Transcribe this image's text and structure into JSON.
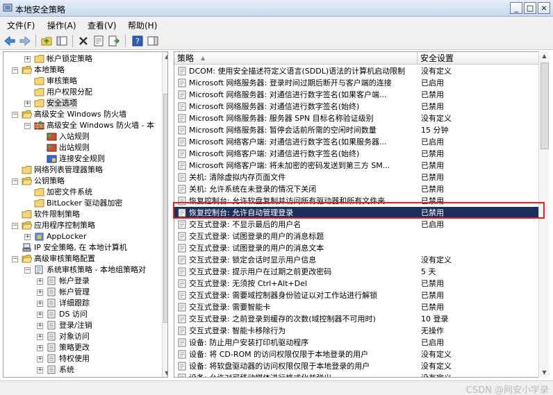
{
  "window": {
    "title": "本地安全策略",
    "minimize": "_",
    "maximize": "□",
    "close": "×"
  },
  "menu": [
    "文件(F)",
    "操作(A)",
    "查看(V)",
    "帮助(H)"
  ],
  "tree": [
    {
      "label": "帐户锁定策略",
      "depth": 2,
      "exp": "+",
      "icon": "folder"
    },
    {
      "label": "本地策略",
      "depth": 1,
      "exp": "−",
      "icon": "folder-open"
    },
    {
      "label": "审核策略",
      "depth": 2,
      "exp": "",
      "icon": "folder"
    },
    {
      "label": "用户权限分配",
      "depth": 2,
      "exp": "",
      "icon": "folder"
    },
    {
      "label": "安全选项",
      "depth": 2,
      "exp": "+",
      "icon": "folder",
      "selected": true
    },
    {
      "label": "高级安全 Windows 防火墙",
      "depth": 1,
      "exp": "−",
      "icon": "folder-open"
    },
    {
      "label": "高级安全 Windows 防火墙 - 本",
      "depth": 2,
      "exp": "−",
      "icon": "firewall"
    },
    {
      "label": "入站规则",
      "depth": 3,
      "exp": "",
      "icon": "rule"
    },
    {
      "label": "出站规则",
      "depth": 3,
      "exp": "",
      "icon": "rule"
    },
    {
      "label": "连接安全规则",
      "depth": 3,
      "exp": "",
      "icon": "rule-blue"
    },
    {
      "label": "网络列表管理器策略",
      "depth": 1,
      "exp": "",
      "icon": "folder"
    },
    {
      "label": "公钥策略",
      "depth": 1,
      "exp": "−",
      "icon": "folder-open"
    },
    {
      "label": "加密文件系统",
      "depth": 2,
      "exp": "",
      "icon": "folder"
    },
    {
      "label": "BitLocker 驱动器加密",
      "depth": 2,
      "exp": "",
      "icon": "folder"
    },
    {
      "label": "软件限制策略",
      "depth": 1,
      "exp": "",
      "icon": "folder"
    },
    {
      "label": "应用程序控制策略",
      "depth": 1,
      "exp": "−",
      "icon": "folder-open"
    },
    {
      "label": "AppLocker",
      "depth": 2,
      "exp": "+",
      "icon": "applocker"
    },
    {
      "label": "IP 安全策略, 在 本地计算机",
      "depth": 1,
      "exp": "",
      "icon": "ipsec"
    },
    {
      "label": "高级审核策略配置",
      "depth": 1,
      "exp": "−",
      "icon": "folder-open"
    },
    {
      "label": "系统审核策略 - 本地组策略对",
      "depth": 2,
      "exp": "−",
      "icon": "audit"
    },
    {
      "label": "帐户登录",
      "depth": 3,
      "exp": "+",
      "icon": "audit-item"
    },
    {
      "label": "帐户管理",
      "depth": 3,
      "exp": "+",
      "icon": "audit-item"
    },
    {
      "label": "详细跟踪",
      "depth": 3,
      "exp": "+",
      "icon": "audit-item"
    },
    {
      "label": "DS 访问",
      "depth": 3,
      "exp": "+",
      "icon": "audit-item"
    },
    {
      "label": "登录/注销",
      "depth": 3,
      "exp": "+",
      "icon": "audit-item"
    },
    {
      "label": "对象访问",
      "depth": 3,
      "exp": "+",
      "icon": "audit-item"
    },
    {
      "label": "策略更改",
      "depth": 3,
      "exp": "+",
      "icon": "audit-item"
    },
    {
      "label": "特权使用",
      "depth": 3,
      "exp": "+",
      "icon": "audit-item"
    },
    {
      "label": "系统",
      "depth": 3,
      "exp": "+",
      "icon": "audit-item"
    }
  ],
  "columns": {
    "policy": "策略",
    "setting": "安全设置"
  },
  "policies": [
    {
      "name": "DCOM: 使用安全描述符定义语言(SDDL)语法的计算机启动限制",
      "value": "没有定义"
    },
    {
      "name": "Microsoft 网络服务器: 登录时间过期后断开与客户端的连接",
      "value": "已启用"
    },
    {
      "name": "Microsoft 网络服务器: 对通信进行数字签名(如果客户端...",
      "value": "已禁用"
    },
    {
      "name": "Microsoft 网络服务器: 对通信进行数字签名(始终)",
      "value": "已禁用"
    },
    {
      "name": "Microsoft 网络服务器: 服务器 SPN 目标名称验证级别",
      "value": "没有定义"
    },
    {
      "name": "Microsoft 网络服务器: 暂停会话前所需的空闲时间数量",
      "value": "15 分钟"
    },
    {
      "name": "Microsoft 网络客户端: 对通信进行数字签名(如果服务器...",
      "value": "已启用"
    },
    {
      "name": "Microsoft 网络客户端: 对通信进行数字签名(始终)",
      "value": "已禁用"
    },
    {
      "name": "Microsoft 网络客户端: 将未加密的密码发送到第三方 SM...",
      "value": "已禁用"
    },
    {
      "name": "关机: 清除虚拟内存页面文件",
      "value": "已禁用"
    },
    {
      "name": "关机: 允许系统在未登录的情况下关闭",
      "value": "已禁用"
    },
    {
      "name": "恢复控制台: 允许软盘复制并访问所有驱动器和所有文件夹",
      "value": "已禁用"
    },
    {
      "name": "恢复控制台: 允许自动管理登录",
      "value": "已禁用",
      "selected": true
    },
    {
      "name": "交互式登录: 不显示最后的用户名",
      "value": "已启用"
    },
    {
      "name": "交互式登录: 试图登录的用户的消息标题",
      "value": ""
    },
    {
      "name": "交互式登录: 试图登录的用户的消息文本",
      "value": ""
    },
    {
      "name": "交互式登录: 锁定会话时显示用户信息",
      "value": "没有定义"
    },
    {
      "name": "交互式登录: 提示用户在过期之前更改密码",
      "value": "5 天"
    },
    {
      "name": "交互式登录: 无须按 Ctrl+Alt+Del",
      "value": "已禁用"
    },
    {
      "name": "交互式登录: 需要域控制器身份验证以对工作站进行解锁",
      "value": "已禁用"
    },
    {
      "name": "交互式登录: 需要智能卡",
      "value": "已禁用"
    },
    {
      "name": "交互式登录: 之前登录到缓存的次数(域控制器不可用时)",
      "value": "10 登录"
    },
    {
      "name": "交互式登录: 智能卡移除行为",
      "value": "无操作"
    },
    {
      "name": "设备: 防止用户安装打印机驱动程序",
      "value": "已启用"
    },
    {
      "name": "设备: 将 CD-ROM 的访问权限仅限于本地登录的用户",
      "value": "没有定义"
    },
    {
      "name": "设备: 将软盘驱动器的访问权限仅限于本地登录的用户",
      "value": "没有定义"
    },
    {
      "name": "设备: 允许对可移动媒体进行格式化并弹出",
      "value": "没有定义"
    }
  ],
  "watermark": "CSDN @网安小学录"
}
